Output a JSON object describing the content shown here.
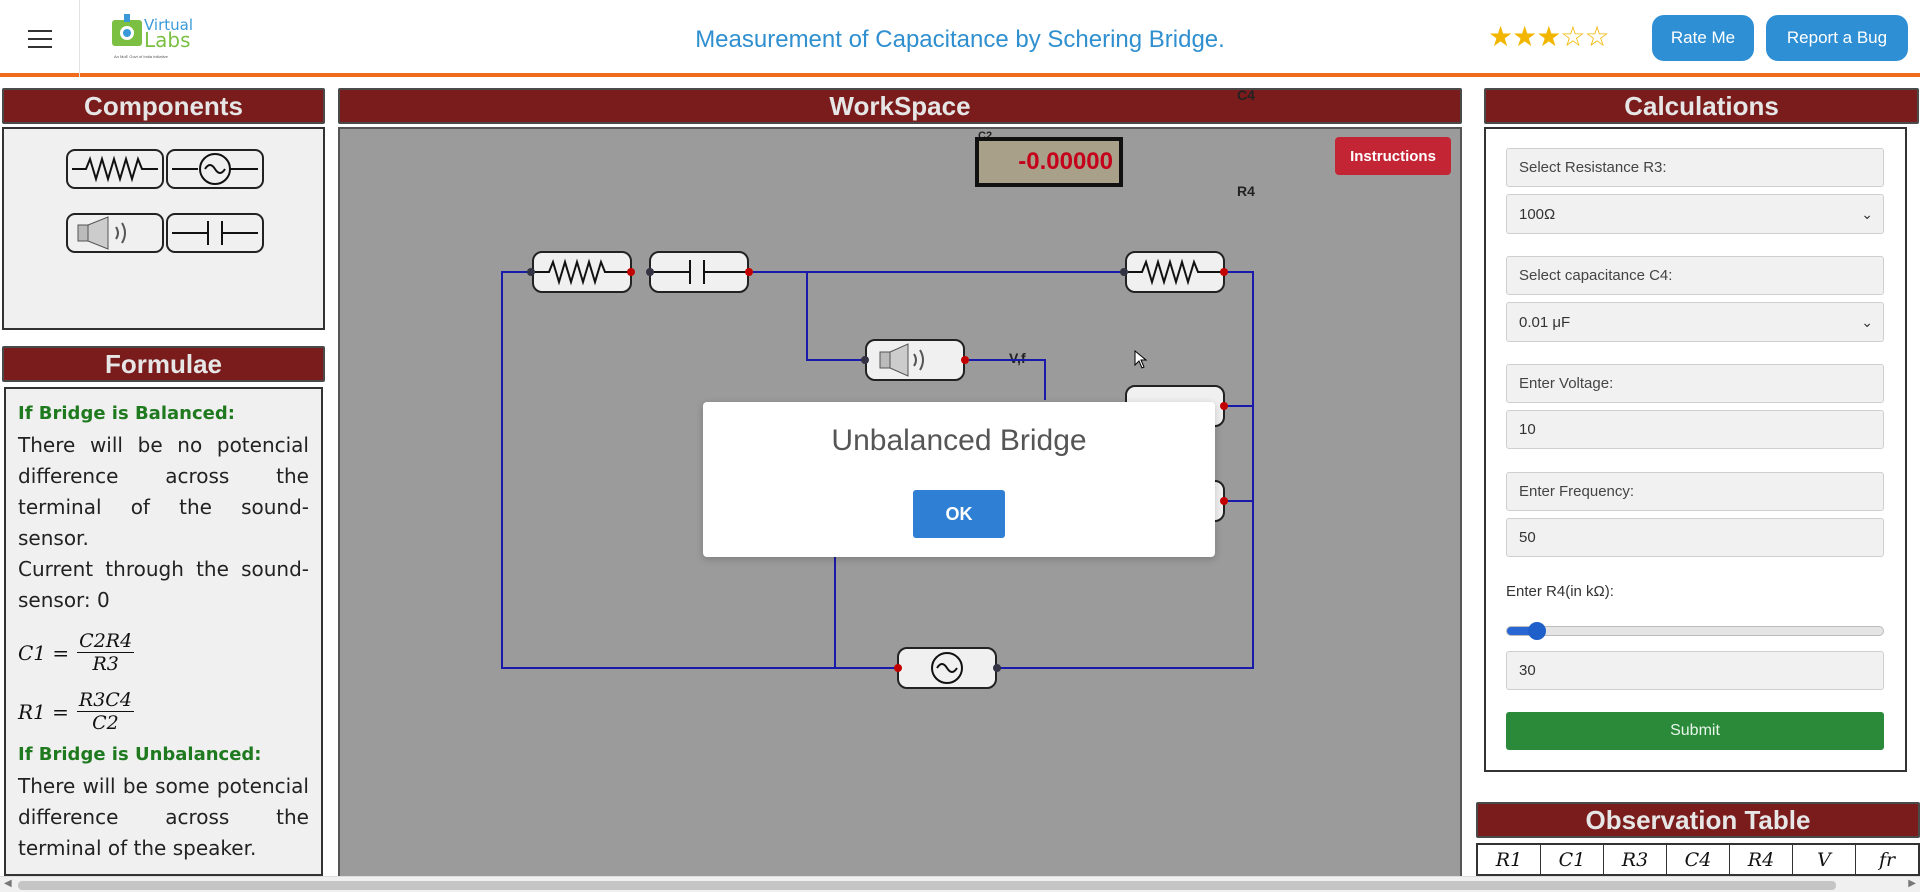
{
  "header": {
    "menu_icon": "hamburger-icon",
    "logo": {
      "line1": "Virtual",
      "line2": "Labs",
      "sub": "An MoE Govt of India Initiative"
    },
    "title": "Measurement of Capacitance by Schering Bridge.",
    "rating": {
      "filled": 3,
      "total": 5,
      "color": "#f2b600"
    },
    "rate_me_label": "Rate Me",
    "report_bug_label": "Report a Bug"
  },
  "components": {
    "title": "Components",
    "items": [
      "resistor-icon",
      "ac-source-icon",
      "speaker-icon",
      "capacitor-icon"
    ]
  },
  "formulae": {
    "title": "Formulae",
    "balanced_heading": "If Bridge is Balanced:",
    "balanced_text1": "There will be no potencial difference across the terminal of the sound-sensor.",
    "balanced_text2": "Current through the sound-sensor: 0",
    "eq1": {
      "lhs": "C1 =",
      "num": "C2R4",
      "den": "R3"
    },
    "eq2": {
      "lhs": "R1 =",
      "num": "R3C4",
      "den": "C2"
    },
    "unbalanced_heading": "If Bridge is Unbalanced:",
    "unbalanced_text": "There will be some potencial difference across the terminal of the speaker."
  },
  "workspace": {
    "title": "WorkSpace",
    "instructions_label": "Instructions",
    "meter_value": "-0.00000",
    "labels": {
      "c4": "C4",
      "r4": "R4",
      "vf": "V,f",
      "c2": "C2"
    },
    "wire_color": "#1a1aaa"
  },
  "modal": {
    "title": "Unbalanced Bridge",
    "ok_label": "OK"
  },
  "calculations": {
    "title": "Calculations",
    "r3_label": "Select Resistance R3:",
    "r3_value": "100Ω",
    "c4_label": "Select capacitance C4:",
    "c4_value": "0.01 μF",
    "voltage_label": "Enter Voltage:",
    "voltage_value": "10",
    "frequency_label": "Enter Frequency:",
    "frequency_value": "50",
    "r4_label": "Enter R4(in kΩ):",
    "r4_slider_fraction": 0.08,
    "r4_value": "30",
    "submit_label": "Submit"
  },
  "observation": {
    "title": "Observation Table",
    "headers": [
      "R1",
      "C1",
      "R3",
      "C4",
      "R4",
      "V",
      "fr"
    ]
  }
}
